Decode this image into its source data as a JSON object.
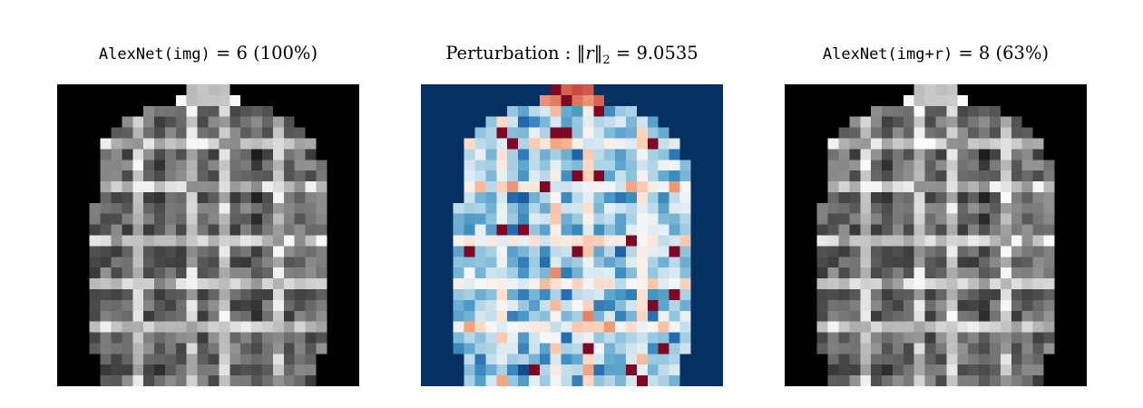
{
  "panels": [
    {
      "key": "original",
      "title": {
        "func": "AlexNet(img)",
        "rest": " = 6 (100%)"
      },
      "colormap": "gray"
    },
    {
      "key": "perturbation",
      "title": {
        "label": "Perturbation : ",
        "norm_open": "‖",
        "var": "r",
        "norm_close": "‖",
        "sub": "2",
        "rest": " = 9.0535"
      },
      "colormap": "RdBu"
    },
    {
      "key": "adversarial",
      "title": {
        "func": "AlexNet(img+r)",
        "rest": " = 8 (63%)"
      },
      "colormap": "gray"
    }
  ],
  "colors": {
    "background": "#000000",
    "rdbu_background": "#053061",
    "rdbu_dark_red": "#67001f",
    "rdbu_light": "#f7f7f7"
  }
}
